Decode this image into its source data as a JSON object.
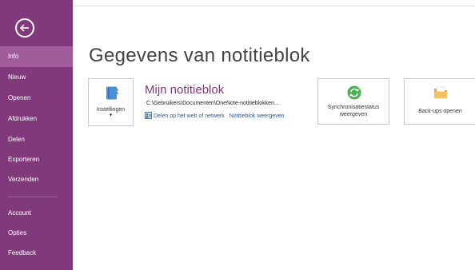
{
  "sidebar": {
    "back_label": "",
    "items": [
      {
        "label": "Info"
      },
      {
        "label": "Nieuw"
      },
      {
        "label": "Openen"
      },
      {
        "label": "Afdrukken"
      },
      {
        "label": "Delen"
      },
      {
        "label": "Exporteren"
      },
      {
        "label": "Verzenden"
      },
      {
        "label": "Account"
      },
      {
        "label": "Opties"
      },
      {
        "label": "Feedback"
      }
    ],
    "active_color": "#a05c9b",
    "background_color": "#80397b"
  },
  "main": {
    "title": "Gegevens van notitieblok",
    "settings_button": {
      "label": "Instellingen",
      "caret": "▾",
      "icon": "notebook-icon"
    },
    "notebook": {
      "name": "Mijn notitieblok",
      "path": "C:\\Gebruikers\\Documenten\\OneNote-notitieblokken...",
      "share_link": "Delen op het web of netwerk",
      "view_link": "Notitieblok weergeven"
    },
    "sync_button": {
      "line1": "Synchronisatiestatus",
      "line2": "weergeven",
      "icon": "sync-icon"
    },
    "backup_button": {
      "label": "Back-ups openen",
      "icon": "folder-icon"
    }
  }
}
